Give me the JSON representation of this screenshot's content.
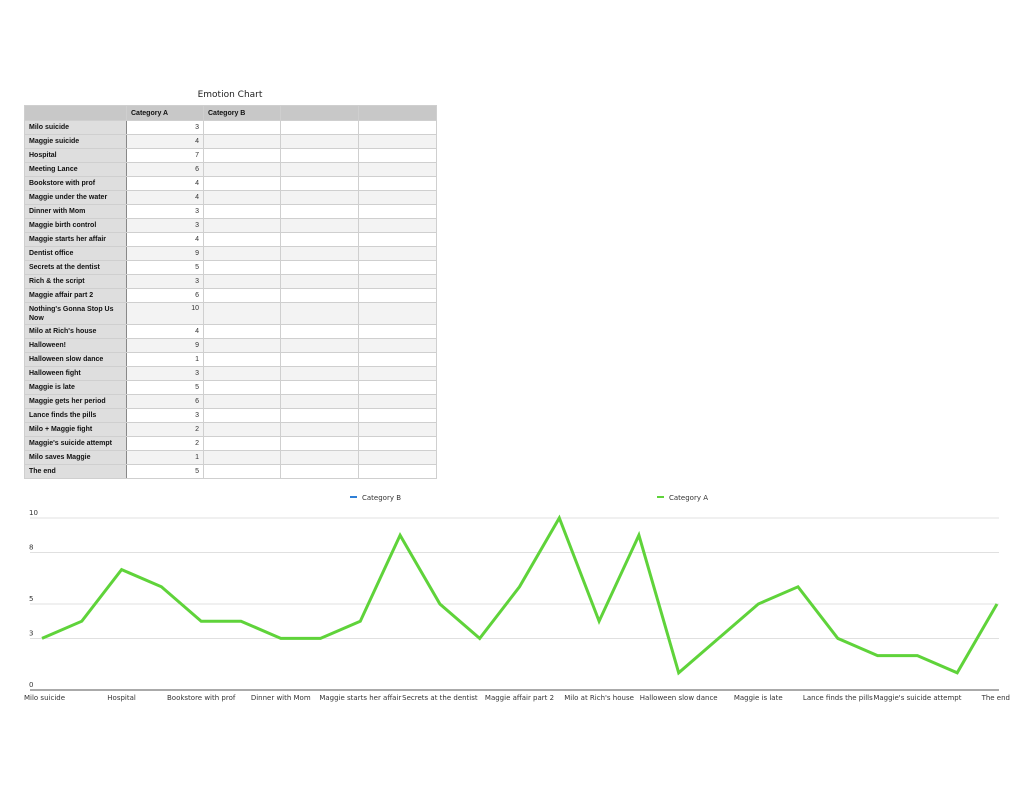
{
  "title": "Emotion Chart",
  "table": {
    "headers": [
      "",
      "Category A",
      "Category B",
      "",
      ""
    ]
  },
  "chart_data": {
    "type": "line",
    "title": "Emotion Chart",
    "categories": [
      "Milo suicide",
      "Maggie suicide",
      "Hospital",
      "Meeting Lance",
      "Bookstore with prof",
      "Maggie under the water",
      "Dinner with Mom",
      "Maggie birth control",
      "Maggie starts her affair",
      "Dentist office",
      "Secrets at the dentist",
      "Rich & the script",
      "Maggie affair part 2",
      "Nothing's Gonna Stop Us Now",
      "Milo at Rich's house",
      "Halloween!",
      "Halloween slow dance",
      "Halloween fight",
      "Maggie is late",
      "Maggie gets her period",
      "Lance finds the pills",
      "Milo + Maggie fight",
      "Maggie's suicide attempt",
      "Milo saves Maggie",
      "The end"
    ],
    "series": [
      {
        "name": "Category A",
        "color": "#5fd33a",
        "values": [
          3,
          4,
          7,
          6,
          4,
          4,
          3,
          3,
          4,
          9,
          5,
          3,
          6,
          10,
          4,
          9,
          1,
          3,
          5,
          6,
          3,
          2,
          2,
          1,
          5
        ]
      },
      {
        "name": "Category B",
        "color": "#2f7fd6",
        "values": []
      }
    ],
    "ylim": [
      0,
      10
    ],
    "yticks": [
      "0",
      "3",
      "5",
      "8",
      "10"
    ],
    "xtick_labels": [
      "Milo suicide",
      "Hospital",
      "Bookstore with prof",
      "Dinner with Mom",
      "Maggie starts her affair",
      "Secrets at the dentist",
      "Maggie affair part 2",
      "Milo at Rich's house",
      "Halloween slow dance",
      "Maggie is late",
      "Lance finds the pills",
      "Maggie's suicide attempt",
      "The end"
    ],
    "legend": [
      {
        "name": "Category B",
        "color": "#2f7fd6"
      },
      {
        "name": "Category A",
        "color": "#5fd33a"
      }
    ],
    "grid": true,
    "legend_position": "top"
  }
}
